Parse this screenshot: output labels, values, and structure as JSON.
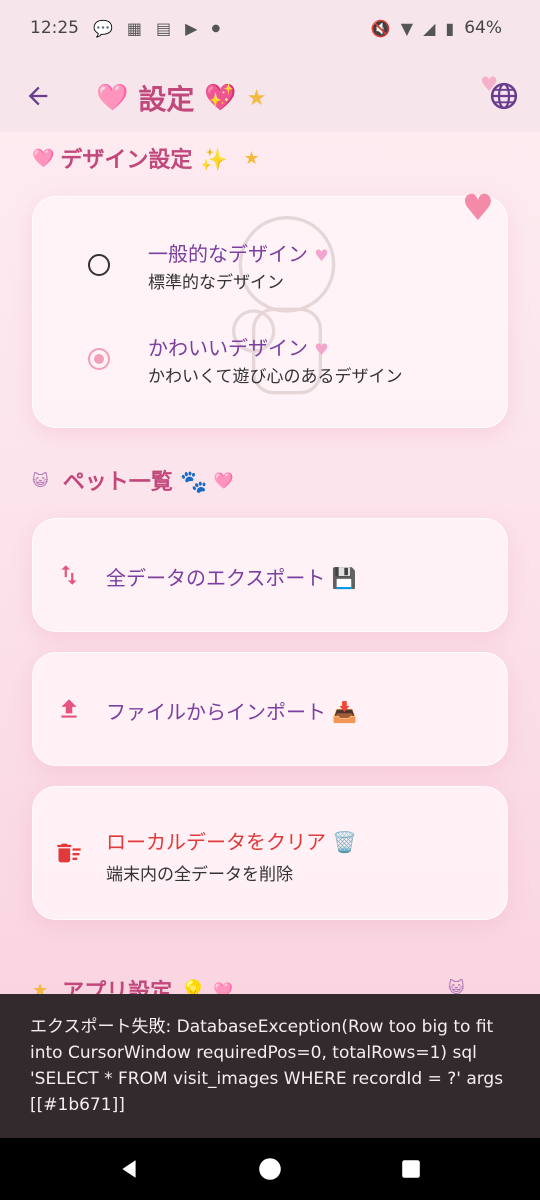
{
  "status": {
    "time": "12:25",
    "left_icons": [
      "chat-icon",
      "calendar-icon",
      "gallery-icon",
      "play-icon",
      "dot-icon"
    ],
    "battery": "64%"
  },
  "app_bar": {
    "title": "設定",
    "deco_left": "🩷",
    "deco_right": "💖",
    "star": "★"
  },
  "design_section": {
    "title": "デザイン設定 ✨",
    "heart": "🩷",
    "star": "★",
    "options": [
      {
        "title": "一般的なデザイン",
        "subtitle": "標準的なデザイン",
        "selected": false
      },
      {
        "title": "かわいいデザイン",
        "subtitle": "かわいくて遊び心のあるデザイン",
        "selected": true
      }
    ]
  },
  "pet_section": {
    "title": "ペット一覧 🐾",
    "lead_icon": "cat-face-icon",
    "heart": "🩷"
  },
  "actions": [
    {
      "label": "全データのエクスポート 💾",
      "icon": "swap-vertical-icon"
    },
    {
      "label": "ファイルからインポート 📥",
      "icon": "upload-icon"
    },
    {
      "label": "ローカルデータをクリア 🗑️",
      "subtitle": "端末内の全データを削除",
      "icon": "delete-sweep-icon",
      "danger": true
    }
  ],
  "app_section": {
    "title": "アプリ設定 💡",
    "star": "★",
    "heart": "🩷"
  },
  "snackbar": {
    "message": "エクスポート失敗: DatabaseException(Row too big to fit into CursorWindow requiredPos=0, totalRows=1) sql 'SELECT * FROM visit_images WHERE recordId = ?' args [[#1b671]]"
  },
  "colors": {
    "accent": "#c2487b",
    "label": "#7a3fa0",
    "danger": "#e23a3a",
    "snackbar_bg": "#322a2d"
  }
}
